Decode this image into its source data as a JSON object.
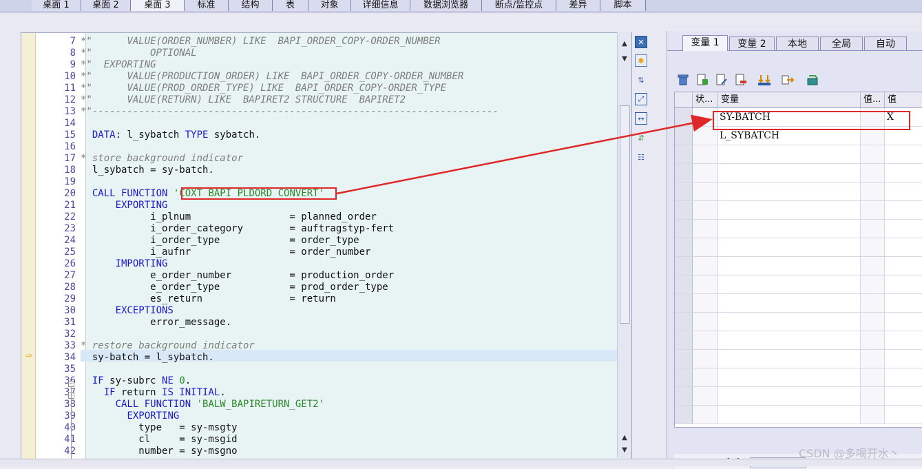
{
  "top_tabs": [
    "桌面 1",
    "桌面 2",
    "桌面 3",
    "标准",
    "结构",
    "表",
    "对象",
    "详细信息",
    "数据浏览器",
    "断点/监控点",
    "差异",
    "脚本"
  ],
  "active_top_tab": "桌面 3",
  "editor": {
    "current_line": 34,
    "lines": [
      {
        "n": "7",
        "html": "<span class='cm'>*\"      VALUE(ORDER_NUMBER) LIKE  BAPI_ORDER_COPY-ORDER_NUMBER</span>"
      },
      {
        "n": "8",
        "html": "<span class='cm'>*\"          OPTIONAL</span>"
      },
      {
        "n": "9",
        "html": "<span class='cm'>*\"  EXPORTING</span>"
      },
      {
        "n": "10",
        "html": "<span class='cm'>*\"      VALUE(PRODUCTION_ORDER) LIKE  BAPI_ORDER_COPY-ORDER_NUMBER</span>"
      },
      {
        "n": "11",
        "html": "<span class='cm'>*\"      VALUE(PROD_ORDER_TYPE) LIKE  BAPI_ORDER_COPY-ORDER_TYPE</span>"
      },
      {
        "n": "12",
        "html": "<span class='cm'>*\"      VALUE(RETURN) LIKE  BAPIRET2 STRUCTURE  BAPIRET2</span>"
      },
      {
        "n": "13",
        "html": "<span class='cm'>*\"----------------------------------------------------------------------</span>"
      },
      {
        "n": "14",
        "html": ""
      },
      {
        "n": "15",
        "html": "  <span class='kw'>DATA</span>: l_sybatch <span class='kw'>TYPE</span> sybatch."
      },
      {
        "n": "16",
        "html": ""
      },
      {
        "n": "17",
        "html": "<span class='cm'>* store background indicator</span>"
      },
      {
        "n": "18",
        "html": "  l_sybatch = sy-batch."
      },
      {
        "n": "19",
        "html": ""
      },
      {
        "n": "20",
        "html": "  <span class='kw'>CALL FUNCTION</span> <span class='st'>'COXT_BAPI_PLDORD_CONVERT'</span>"
      },
      {
        "n": "21",
        "html": "      <span class='kw'>EXPORTING</span>"
      },
      {
        "n": "22",
        "html": "            i_plnum                 = planned_order"
      },
      {
        "n": "23",
        "html": "            i_order_category        = auftragstyp-fert"
      },
      {
        "n": "24",
        "html": "            i_order_type            = order_type"
      },
      {
        "n": "25",
        "html": "            i_aufnr                 = order_number"
      },
      {
        "n": "26",
        "html": "      <span class='kw'>IMPORTING</span>"
      },
      {
        "n": "27",
        "html": "            e_order_number          = production_order"
      },
      {
        "n": "28",
        "html": "            e_order_type            = prod_order_type"
      },
      {
        "n": "29",
        "html": "            es_return               = return"
      },
      {
        "n": "30",
        "html": "      <span class='kw'>EXCEPTIONS</span>"
      },
      {
        "n": "31",
        "html": "            error_message."
      },
      {
        "n": "32",
        "html": ""
      },
      {
        "n": "33",
        "html": "<span class='cm'>* restore background indicator</span>"
      },
      {
        "n": "34",
        "html": "  sy-batch = l_sybatch."
      },
      {
        "n": "35",
        "html": ""
      },
      {
        "n": "36",
        "html": "  <span class='kw'>IF</span> sy-subrc <span class='kw'>NE</span> <span class='nm'>0</span>."
      },
      {
        "n": "37",
        "html": "    <span class='kw'>IF</span> return <span class='kw'>IS INITIAL</span>."
      },
      {
        "n": "38",
        "html": "      <span class='kw'>CALL FUNCTION</span> <span class='st'>'BALW_BAPIRETURN_GET2'</span>"
      },
      {
        "n": "39",
        "html": "        <span class='kw'>EXPORTING</span>"
      },
      {
        "n": "40",
        "html": "          type   = sy-msgty"
      },
      {
        "n": "41",
        "html": "          cl     = sy-msgid"
      },
      {
        "n": "42",
        "html": "          number = sy-msgno"
      }
    ]
  },
  "right_tabs": [
    "变量 1",
    "变量 2",
    "本地",
    "全局",
    "自动"
  ],
  "active_right_tab": "变量 1",
  "var_table": {
    "headers": {
      "status": "状...",
      "variable": "变量",
      "value_hex": "值...",
      "value": "值"
    },
    "rows": [
      {
        "variable": "SY-BATCH",
        "value": "X"
      },
      {
        "variable": "L_SYBATCH",
        "value": ""
      }
    ],
    "empty_rows": 15
  },
  "watermark": "CSDN @多喝开水丶",
  "colors": {
    "highlight_box": "#e02828",
    "keyword": "#1a1acc",
    "comment": "#7d7d7d",
    "literal": "#2a8a2a"
  }
}
